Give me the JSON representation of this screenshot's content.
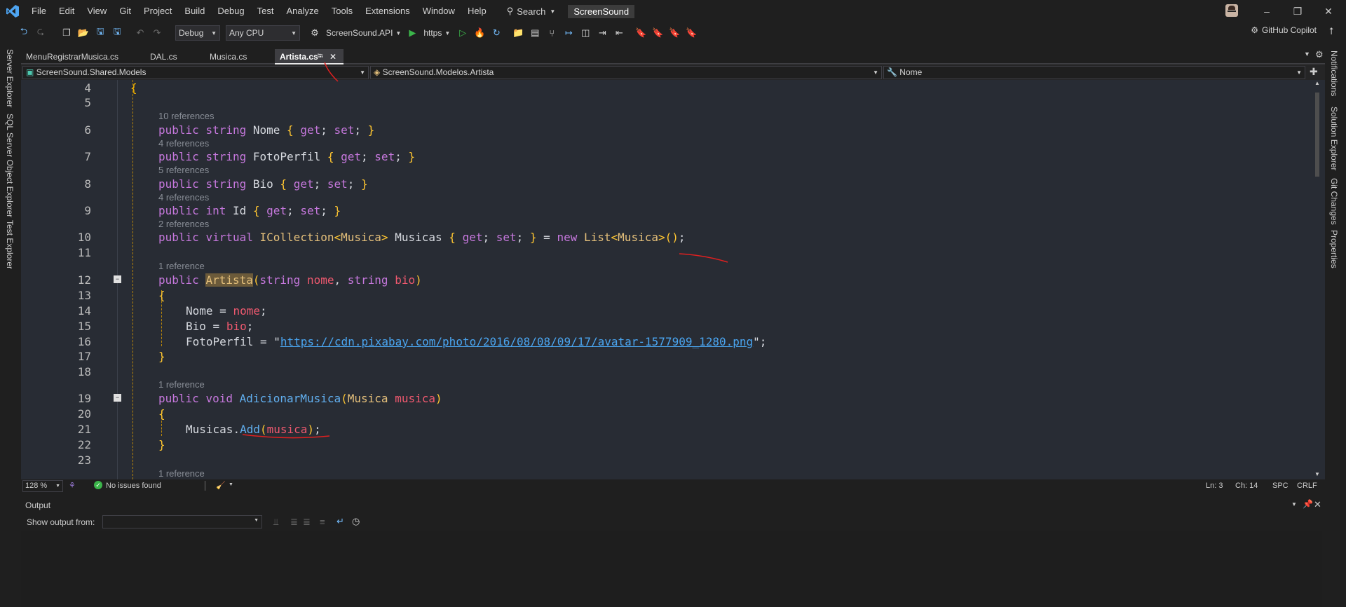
{
  "menubar": {
    "items": [
      "File",
      "Edit",
      "View",
      "Git",
      "Project",
      "Build",
      "Debug",
      "Test",
      "Analyze",
      "Tools",
      "Extensions",
      "Window",
      "Help"
    ],
    "search_label": "Search",
    "solution_name": "ScreenSound"
  },
  "toolbar": {
    "config": "Debug",
    "platform": "Any CPU",
    "startup_project": "ScreenSound.API",
    "run_label": "https",
    "copilot_label": "GitHub Copilot"
  },
  "left_tabs": [
    "Server Explorer",
    "SQL Server Object Explorer",
    "Test Explorer"
  ],
  "right_tabs": [
    "Notifications",
    "Solution Explorer",
    "Git Changes",
    "Properties"
  ],
  "tabs": [
    {
      "label": "MenuRegistrarMusica.cs"
    },
    {
      "label": "DAL.cs"
    },
    {
      "label": "Musica.cs"
    },
    {
      "label": "Artista.cs",
      "active": true
    }
  ],
  "navbar": {
    "project": "ScreenSound.Shared.Models",
    "type": "ScreenSound.Modelos.Artista",
    "member": "Nome"
  },
  "editor": {
    "lines": {
      "n4": "4",
      "n5": "5",
      "n6": "6",
      "n7": "7",
      "n8": "8",
      "n9": "9",
      "n10": "10",
      "n11": "11",
      "n12": "12",
      "n13": "13",
      "n14": "14",
      "n15": "15",
      "n16": "16",
      "n17": "17",
      "n18": "18",
      "n19": "19",
      "n20": "20",
      "n21": "21",
      "n22": "22",
      "n23": "23"
    },
    "refs": {
      "r6": "10 references",
      "r7": "4 references",
      "r8": "5 references",
      "r9": "4 references",
      "r10": "2 references",
      "r12": "1 reference",
      "r19": "1 reference",
      "r24": "1 reference"
    },
    "tokens": {
      "public": "public",
      "string": "string",
      "int": "int",
      "virtual": "virtual",
      "void": "void",
      "new": "new",
      "Nome": "Nome",
      "FotoPerfil": "FotoPerfil",
      "Bio": "Bio",
      "Id": "Id",
      "get": "get",
      "set": "set",
      "ICollection": "ICollection",
      "Musica": "Musica",
      "Musicas": "Musicas",
      "List": "List",
      "Artista": "Artista",
      "nome": "nome",
      "bio": "bio",
      "url": "https://cdn.pixabay.com/photo/2016/08/08/09/17/avatar-1577909_1280.png",
      "AdicionarMusica": "AdicionarMusica",
      "musica": "musica",
      "Add": "Add"
    }
  },
  "statusbar": {
    "zoom": "128 %",
    "issues": "No issues found",
    "ln": "Ln: 3",
    "ch": "Ch: 14",
    "spc": "SPC",
    "crlf": "CRLF"
  },
  "output": {
    "title": "Output",
    "show_from_label": "Show output from:",
    "show_from_value": ""
  }
}
